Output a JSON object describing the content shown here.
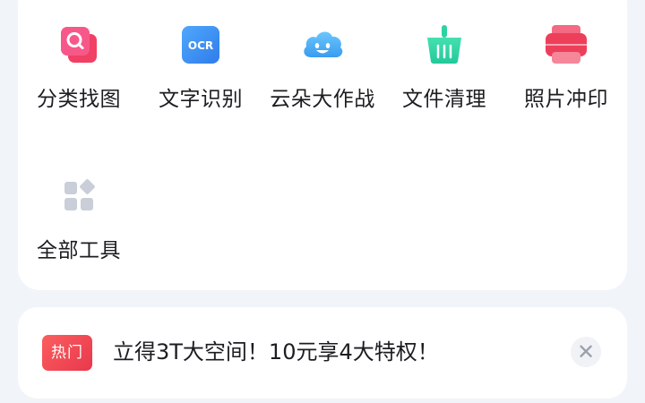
{
  "tools": {
    "items": [
      {
        "label": "分类找图",
        "icon": "photo-search-icon"
      },
      {
        "label": "文字识别",
        "icon": "ocr-icon",
        "icon_text": "OCR"
      },
      {
        "label": "云朵大作战",
        "icon": "cloud-smile-icon"
      },
      {
        "label": "文件清理",
        "icon": "cleanup-basket-icon"
      },
      {
        "label": "照片冲印",
        "icon": "photo-print-icon"
      },
      {
        "label": "全部工具",
        "icon": "all-tools-grid-icon"
      }
    ]
  },
  "promo": {
    "badge": "热门",
    "text": "立得3T大空间！10元享4大特权！",
    "close_symbol": "✕"
  },
  "colors": {
    "background": "#f1f4f9",
    "card": "#ffffff",
    "badge_red": "#f04a55",
    "ocr_blue": "#3d8ef0",
    "cloud_blue": "#4fb3f6",
    "clean_green": "#35d8a4",
    "print_red": "#ee3f5a",
    "grid_gray": "#c9ced8"
  }
}
